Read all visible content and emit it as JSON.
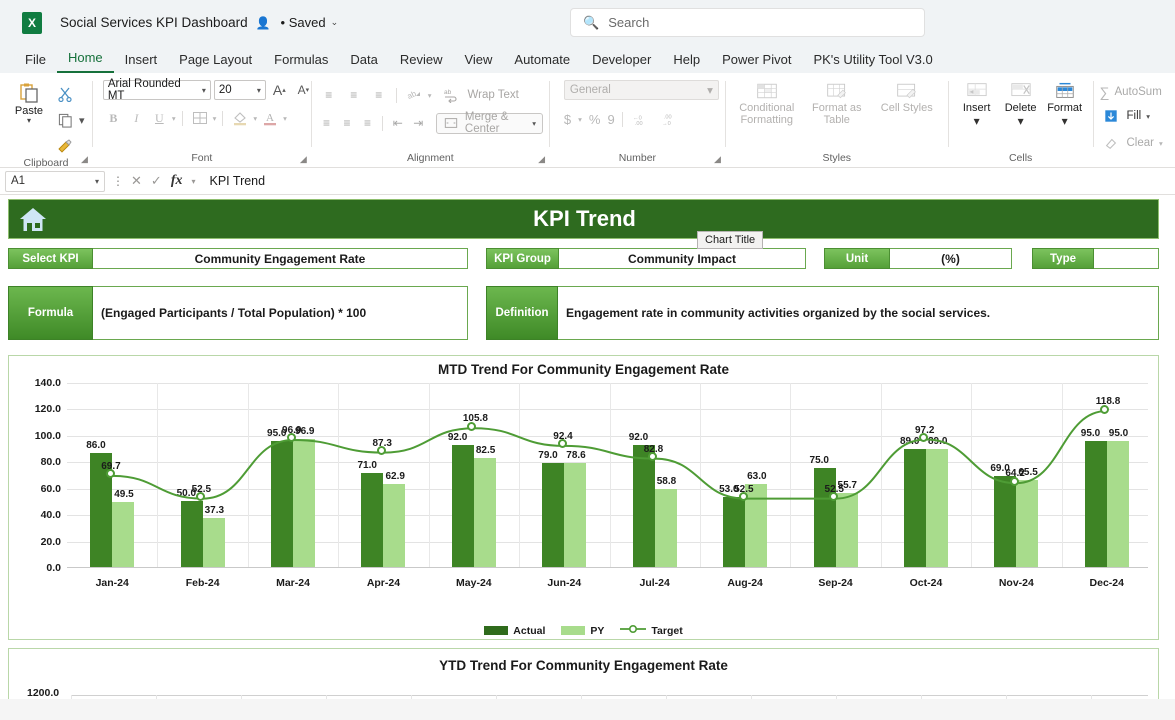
{
  "titlebar": {
    "app_icon": "excel-logo",
    "logo_letter": "X",
    "document_title": "Social Services KPI Dashboard",
    "person_icon": "person-share-icon",
    "saved_status": "• Saved",
    "chevron": "⌄"
  },
  "search": {
    "icon": "search-icon",
    "placeholder": "Search"
  },
  "tabs": [
    {
      "label": "File",
      "active": false
    },
    {
      "label": "Home",
      "active": true
    },
    {
      "label": "Insert",
      "active": false
    },
    {
      "label": "Page Layout",
      "active": false
    },
    {
      "label": "Formulas",
      "active": false
    },
    {
      "label": "Data",
      "active": false
    },
    {
      "label": "Review",
      "active": false
    },
    {
      "label": "View",
      "active": false
    },
    {
      "label": "Automate",
      "active": false
    },
    {
      "label": "Developer",
      "active": false
    },
    {
      "label": "Help",
      "active": false
    },
    {
      "label": "Power Pivot",
      "active": false
    },
    {
      "label": "PK's Utility Tool V3.0",
      "active": false
    }
  ],
  "ribbon": {
    "clipboard": {
      "group_label": "Clipboard",
      "paste_label": "Paste",
      "paste_icon": "paste-icon",
      "cut_icon": "scissors-icon",
      "copy_icon": "copy-icon",
      "format_painter_icon": "format-painter-icon",
      "launcher_icon": "dialog-launcher-icon"
    },
    "font": {
      "group_label": "Font",
      "font_name": "Arial Rounded MT",
      "font_size": "20",
      "grow_font_icon": "grow-font-icon",
      "shrink_font_icon": "shrink-font-icon",
      "bold": "B",
      "italic": "I",
      "underline": "U",
      "borders_icon": "borders-icon",
      "fill_color_icon": "fill-color-icon",
      "font_color_icon": "font-color-icon",
      "launcher_icon": "dialog-launcher-icon"
    },
    "alignment": {
      "group_label": "Alignment",
      "align_top_icon": "align-top-icon",
      "align_middle_icon": "align-middle-icon",
      "align_bottom_icon": "align-bottom-icon",
      "orientation_icon": "orientation-icon",
      "align_left_icon": "align-left-icon",
      "align_center_icon": "align-center-icon",
      "align_right_icon": "align-right-icon",
      "decrease_indent_icon": "decrease-indent-icon",
      "increase_indent_icon": "increase-indent-icon",
      "wrap_text_label": "Wrap Text",
      "wrap_text_icon": "wrap-text-icon",
      "merge_center_label": "Merge & Center",
      "merge_center_icon": "merge-cells-icon",
      "launcher_icon": "dialog-launcher-icon"
    },
    "number": {
      "group_label": "Number",
      "format_value": "General",
      "currency_icon": "$",
      "percent_icon": "%",
      "comma_icon": "9",
      "increase_decimal_icon": "increase-decimal-icon",
      "decrease_decimal_icon": "decrease-decimal-icon",
      "launcher_icon": "dialog-launcher-icon"
    },
    "styles": {
      "group_label": "Styles",
      "conditional_formatting": "Conditional Formatting",
      "format_as_table": "Format as Table",
      "cell_styles": "Cell Styles"
    },
    "cells": {
      "group_label": "Cells",
      "insert": "Insert",
      "delete": "Delete",
      "format": "Format"
    },
    "editing": {
      "autosum": "AutoSum",
      "fill": "Fill",
      "clear": "Clear",
      "autosum_icon": "sigma-icon",
      "fill_icon": "fill-down-icon",
      "clear_icon": "eraser-icon"
    }
  },
  "formula_bar": {
    "cell_reference": "A1",
    "cancel_icon": "cancel-icon",
    "enter_icon": "enter-icon",
    "function_icon": "fx",
    "content": "KPI Trend"
  },
  "dashboard": {
    "home_icon": "home-icon",
    "header_title": "KPI Trend",
    "fields": [
      {
        "label": "Select KPI",
        "value": "Community Engagement Rate"
      },
      {
        "label": "KPI Group",
        "value": "Community Impact"
      },
      {
        "label": "Unit",
        "value": "(%)"
      },
      {
        "label": "Type",
        "value": ""
      }
    ],
    "boxes": [
      {
        "label": "Formula",
        "value": "(Engaged Participants / Total Population) * 100"
      },
      {
        "label": "Definition",
        "value": "Engagement rate in community activities organized by the social services."
      }
    ],
    "tooltip": "Chart Title",
    "colors": {
      "header_green": "#2e6b1f",
      "actual_green": "#3e8425",
      "py_green": "#a8dc8c",
      "target_line": "#4e9c35",
      "label_gradient_top": "#7cc35e",
      "label_gradient_bottom": "#55a038"
    }
  },
  "chart_data": [
    {
      "type": "bar",
      "title": "MTD Trend For Community Engagement Rate",
      "categories": [
        "Jan-24",
        "Feb-24",
        "Mar-24",
        "Apr-24",
        "May-24",
        "Jun-24",
        "Jul-24",
        "Aug-24",
        "Sep-24",
        "Oct-24",
        "Nov-24",
        "Dec-24"
      ],
      "series": [
        {
          "name": "Actual",
          "type": "bar",
          "color": "#3e8425",
          "values": [
            86.0,
            50.0,
            95.0,
            71.0,
            92.0,
            79.0,
            92.0,
            53.0,
            75.0,
            89.0,
            69.0,
            95.0
          ]
        },
        {
          "name": "PY",
          "type": "bar",
          "color": "#a8dc8c",
          "values": [
            49.5,
            37.3,
            96.9,
            62.9,
            82.5,
            78.6,
            58.8,
            63.0,
            55.7,
            89.0,
            65.5,
            95.0
          ]
        },
        {
          "name": "Target",
          "type": "line",
          "color": "#4e9c35",
          "values": [
            69.7,
            52.5,
            96.9,
            87.3,
            105.8,
            92.4,
            82.8,
            52.5,
            52.5,
            97.2,
            64.2,
            118.8
          ]
        }
      ],
      "ylim": [
        0,
        140
      ],
      "yticks": [
        "0.0",
        "20.0",
        "40.0",
        "60.0",
        "80.0",
        "100.0",
        "120.0",
        "140.0"
      ],
      "xlabel": "",
      "ylabel": "",
      "grid": true,
      "legend_position": "bottom",
      "legend": [
        "Actual",
        "PY",
        "Target"
      ]
    },
    {
      "type": "bar",
      "title": "YTD Trend For Community Engagement Rate",
      "categories": [],
      "series": [],
      "yticks": [
        "1200.0"
      ],
      "ylim": [
        0,
        1200
      ],
      "grid": true,
      "legend_position": "bottom",
      "note": "partially visible below the fold"
    }
  ]
}
